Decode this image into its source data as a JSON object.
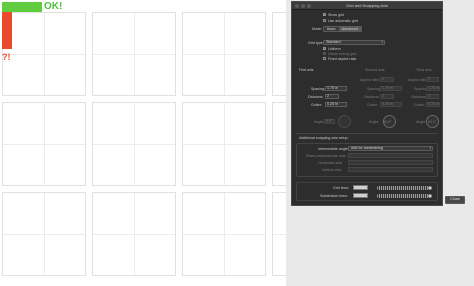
{
  "overlay": {
    "ok_text": "OK!",
    "fail_text": "?!"
  },
  "dialog": {
    "title": "Grid and Snapping Axis",
    "show_grid": "Show grid",
    "use_automatic_grid": "Use automatic grid",
    "mode_label": "Mode:",
    "mode_options": [
      "Basic",
      "Advanced"
    ],
    "grid_type_label": "Grid type:",
    "grid_type_value": "Standard",
    "uniform": "Uniform",
    "divide_evenly": "Divide evenly grid",
    "fixed_aspect": "Fixed aspect ratio",
    "columns": [
      "First axis",
      "Second axis",
      "Third axis"
    ],
    "aspect_ratio_label": "Aspect ratio:",
    "spacing_label": "Spacing:",
    "divisions_label": "Divisions:",
    "gutter_label": "Gutter:",
    "angle_label": "Angle:",
    "first": {
      "spacing": "1.75 in",
      "divisions": "2",
      "gutter": "0.25 in",
      "angle": "0.0°"
    },
    "second": {
      "aspect": "1",
      "spacing": "1.75 in",
      "divisions": "2",
      "gutter": "0.25 in",
      "angle": "90.0°"
    },
    "third": {
      "aspect": "1",
      "spacing": "1.75 in",
      "divisions": "2",
      "gutter": "0.25 in",
      "angle": "90.0°"
    },
    "additional_title": "Additional snapping axis setup:",
    "intermediate_label": "Intermediate angles:",
    "intermediate_value": "Add for constraining",
    "plane_label": "Plane perpendicular axis:",
    "horizontal_label": "Horizontal axis:",
    "vertical_label": "Vertical axis:",
    "grid_lines_label": "Grid lines:",
    "subdivision_lines_label": "Subdivision lines:",
    "close_label": "Close"
  }
}
